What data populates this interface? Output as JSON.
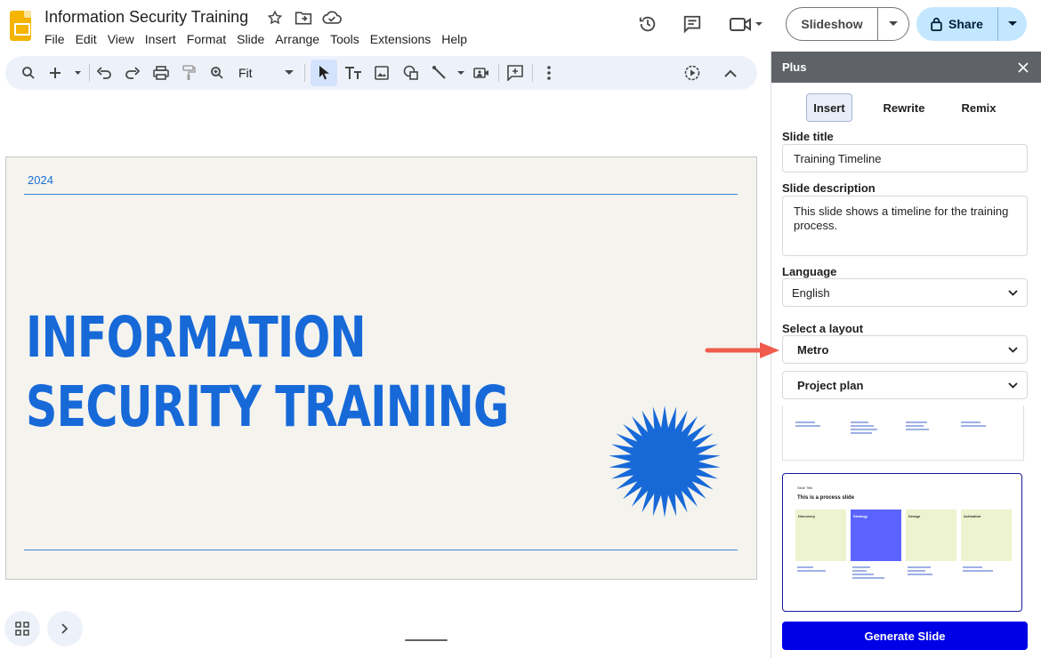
{
  "header": {
    "doc_title": "Information Security Training",
    "menu": [
      "File",
      "Edit",
      "View",
      "Insert",
      "Format",
      "Slide",
      "Arrange",
      "Tools",
      "Extensions",
      "Help"
    ],
    "slideshow_label": "Slideshow",
    "share_label": "Share"
  },
  "toolbar": {
    "zoom_label": "Fit"
  },
  "slide": {
    "year": "2024",
    "title_line1": "INFORMATION",
    "title_line2": "SECURITY TRAINING"
  },
  "panel": {
    "title": "Plus",
    "tabs": [
      {
        "label": "Insert",
        "active": true
      },
      {
        "label": "Rewrite",
        "active": false
      },
      {
        "label": "Remix",
        "active": false
      }
    ],
    "slide_title_label": "Slide title",
    "slide_title_value": "Training Timeline",
    "slide_description_label": "Slide description",
    "slide_description_value": "This slide shows a timeline for the training process.",
    "language_label": "Language",
    "language_value": "English",
    "layout_label": "Select a layout",
    "layout_theme_value": "Metro",
    "layout_type_value": "Project plan",
    "generate_label": "Generate Slide",
    "preview2": {
      "kicker": "Slide Title",
      "heading": "This is a process slide",
      "cards": [
        "Discovery",
        "Strategy",
        "Design",
        "Activation"
      ]
    }
  },
  "colors": {
    "brand_blue": "#1769d8",
    "generate_button": "#0000e6",
    "share_button": "#c2e7ff",
    "arrow": "#ef5b4c",
    "card_green": "#eef3cf",
    "card_purple": "#5b63ff"
  }
}
